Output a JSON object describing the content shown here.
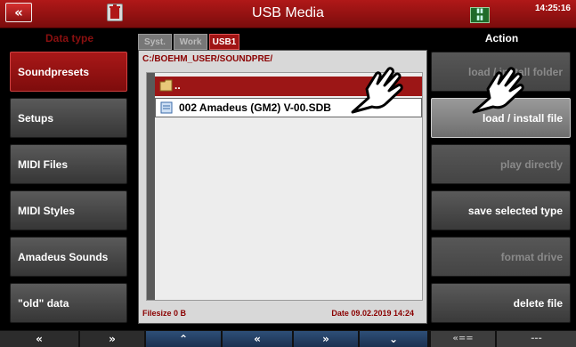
{
  "header": {
    "back_icon": "«",
    "title": "USB Media",
    "time": "14:25:16"
  },
  "left": {
    "heading": "Data type",
    "items": [
      {
        "label": "Soundpresets",
        "active": true
      },
      {
        "label": "Setups"
      },
      {
        "label": "MIDI Files"
      },
      {
        "label": "MIDI Styles"
      },
      {
        "label": "Amadeus Sounds"
      },
      {
        "label": "\"old\" data"
      }
    ]
  },
  "center": {
    "tabs": [
      "Syst.",
      "Work",
      "USB1"
    ],
    "active_tab": "USB1",
    "path": "C:/BOEHM_USER/SOUNDPRE/",
    "parent_folder": "..",
    "file_name": "002  Amadeus (GM2) V-00.SDB",
    "filesize": "Filesize  0 B",
    "date": "Date  09.02.2019   14:24"
  },
  "right": {
    "heading": "Action",
    "buttons": [
      {
        "label": "load  /  install  folder",
        "state": "disabled"
      },
      {
        "label": "load  /  install  file",
        "state": "highlight"
      },
      {
        "label": "play  directly",
        "state": "disabled"
      },
      {
        "label": "save  selected  type",
        "state": "enabled"
      },
      {
        "label": "format  drive",
        "state": "disabled"
      },
      {
        "label": "delete  file",
        "state": "enabled"
      }
    ]
  },
  "bottom": {
    "buttons": [
      "«",
      "»",
      "⌃",
      "«",
      "»",
      "⌄",
      "«==",
      "---"
    ]
  },
  "colors": {
    "accent_red": "#a01414",
    "panel_bg": "#d8d8d8",
    "bottom_blue": "#2e4f78"
  }
}
